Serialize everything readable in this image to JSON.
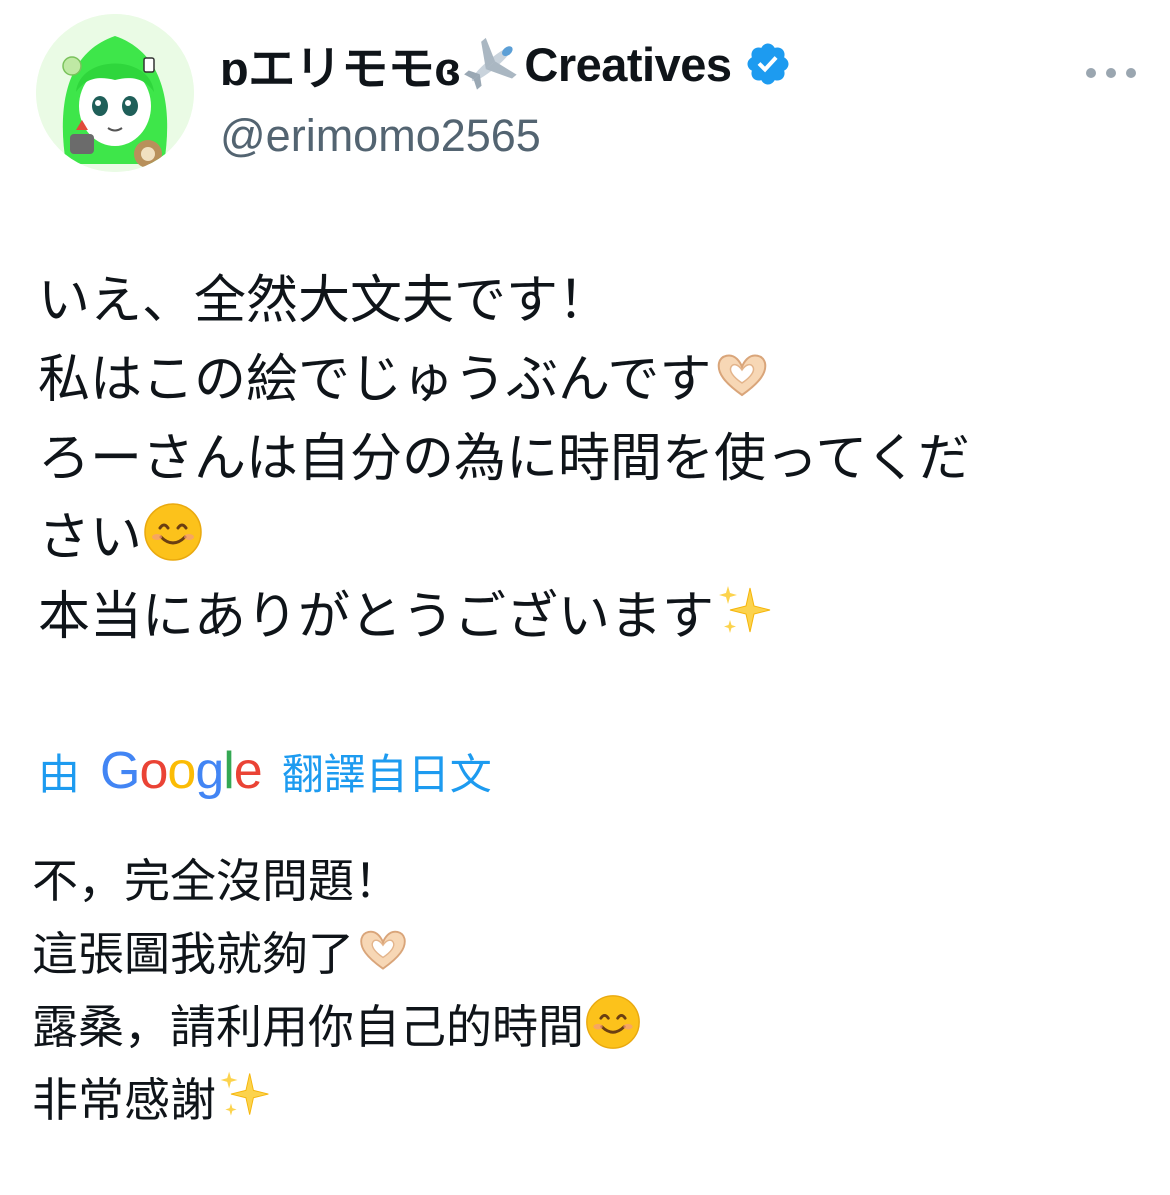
{
  "author": {
    "display_name_prefix": "ɒエリモモɞ",
    "display_name_suffix": "Creatives",
    "handle": "@erimomo2565",
    "verified": true
  },
  "post": {
    "lines": [
      "いえ、全然大文夫です！",
      "私はこの絵でじゅうぶんです",
      "ろーさんは自分の為に時間を使ってくだ",
      "さい",
      "本当にありがとうございます"
    ]
  },
  "translation": {
    "prefix": "由",
    "google": [
      "G",
      "o",
      "o",
      "g",
      "l",
      "e"
    ],
    "suffix": "翻譯自日文",
    "lines": [
      "不，完全沒問題！",
      "這張圖我就夠了",
      "露桑，請利用你自己的時間",
      "非常感謝"
    ]
  },
  "icons": {
    "more": "more-icon",
    "verified": "verified-icon",
    "plane": "airplane-icon",
    "heart_hands": "heart-hands-icon",
    "smile": "smiling-face-icon",
    "sparkles": "sparkles-icon"
  },
  "colors": {
    "text": "#0f1419",
    "secondary": "#536471",
    "link": "#1d9bf0",
    "verified": "#1d9bf0",
    "google_blue": "#4285f4",
    "google_red": "#ea4335",
    "google_yellow": "#fbbc05",
    "google_green": "#34a853"
  }
}
